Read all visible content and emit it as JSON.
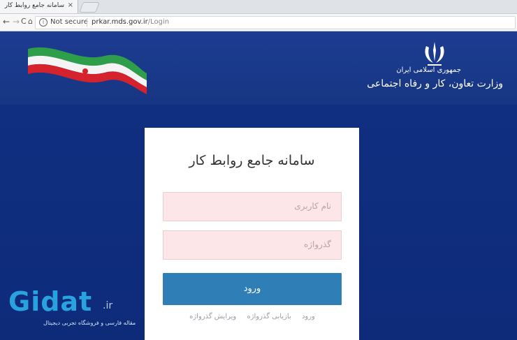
{
  "browser": {
    "tab_title": "سامانه جامع روابط کار -",
    "tab_close": "×",
    "back": "←",
    "forward": "→",
    "reload": "C",
    "home": "⌂",
    "security_text": "Not secure",
    "url_host": "prkar.mds.gov.ir",
    "url_path": "/Login"
  },
  "header": {
    "ministry_line1": "جمهوری اسلامی ایران",
    "ministry_line2": "وزارت تعاون، کار و رفاه اجتماعی"
  },
  "login": {
    "title": "سامانه جامع روابط کار",
    "username_placeholder": "نام کاربری",
    "password_placeholder": "گذرواژه",
    "submit_label": "ورود",
    "links": [
      "ورود",
      "بازیابی گذرواژه",
      "ویرایش گذرواژه"
    ]
  },
  "watermark": {
    "name": "Gidat",
    "tld": ".ir",
    "subtitle": "مقاله فارسی و فروشگاه تجربی دیجیتال"
  },
  "colors": {
    "background": "#0f2f86",
    "button": "#2f7fb6",
    "field_bg": "#fde6e7"
  }
}
